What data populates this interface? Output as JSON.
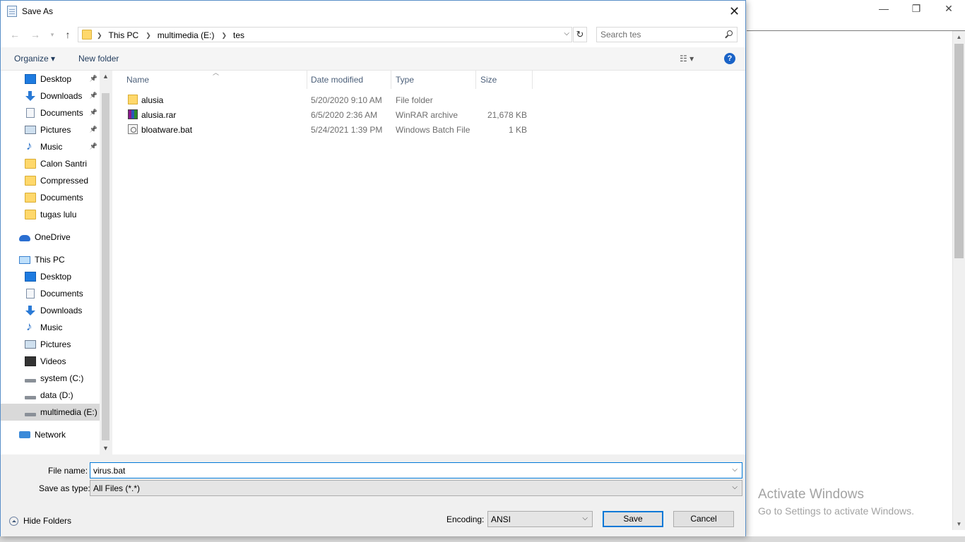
{
  "background": {
    "window_controls": [
      "—",
      "❐",
      "✕"
    ],
    "watermark": {
      "line1": "Activate Windows",
      "line2": "Go to Settings to activate Windows."
    }
  },
  "dialog": {
    "title": "Save As",
    "close_glyph": "✕"
  },
  "address": {
    "crumbs": [
      "This PC",
      "multimedia (E:)",
      "tes"
    ],
    "search_placeholder": "Search tes"
  },
  "toolbar": {
    "organize_label": "Organize ▾",
    "new_folder_label": "New folder",
    "view_glyph": "☷ ▾",
    "help_glyph": "?"
  },
  "nav_pane": {
    "items": [
      {
        "label": "Desktop",
        "icon": "desktop",
        "pinned": true
      },
      {
        "label": "Downloads",
        "icon": "down",
        "pinned": true
      },
      {
        "label": "Documents",
        "icon": "doc",
        "pinned": true
      },
      {
        "label": "Pictures",
        "icon": "pic",
        "pinned": true
      },
      {
        "label": "Music",
        "icon": "music",
        "pinned": true
      },
      {
        "label": "Calon Santri",
        "icon": "folder",
        "pinned": false
      },
      {
        "label": "Compressed",
        "icon": "folder",
        "pinned": false
      },
      {
        "label": "Documents",
        "icon": "folder",
        "pinned": false
      },
      {
        "label": "tugas lulu",
        "icon": "folder",
        "pinned": false
      },
      {
        "label": "OneDrive",
        "icon": "cloud",
        "pinned": false
      },
      {
        "label": "This PC",
        "icon": "pc",
        "pinned": false
      },
      {
        "label": "Desktop",
        "icon": "desktop",
        "pinned": false
      },
      {
        "label": "Documents",
        "icon": "doc",
        "pinned": false
      },
      {
        "label": "Downloads",
        "icon": "down",
        "pinned": false
      },
      {
        "label": "Music",
        "icon": "music",
        "pinned": false
      },
      {
        "label": "Pictures",
        "icon": "pic",
        "pinned": false
      },
      {
        "label": "Videos",
        "icon": "video",
        "pinned": false
      },
      {
        "label": "system (C:)",
        "icon": "drive-c",
        "pinned": false
      },
      {
        "label": "data (D:)",
        "icon": "drive",
        "pinned": false
      },
      {
        "label": "multimedia (E:)",
        "icon": "drive",
        "pinned": false,
        "selected": true
      },
      {
        "label": "Network",
        "icon": "net",
        "pinned": false
      }
    ]
  },
  "file_list": {
    "columns": [
      "Name",
      "Date modified",
      "Type",
      "Size"
    ],
    "rows": [
      {
        "name": "alusia",
        "date": "5/20/2020 9:10 AM",
        "type": "File folder",
        "size": "",
        "icon": "folder"
      },
      {
        "name": "alusia.rar",
        "date": "6/5/2020 2:36 AM",
        "type": "WinRAR archive",
        "size": "21,678 KB",
        "icon": "rar"
      },
      {
        "name": "bloatware.bat",
        "date": "5/24/2021 1:39 PM",
        "type": "Windows Batch File",
        "size": "1 KB",
        "icon": "bat"
      }
    ]
  },
  "bottom": {
    "file_name_label": "File name:",
    "file_name_value": "virus.bat",
    "save_type_label": "Save as type:",
    "save_type_value": "All Files  (*.*)",
    "hide_folders_label": "Hide Folders",
    "encoding_label": "Encoding:",
    "encoding_value": "ANSI",
    "save_label": "Save",
    "cancel_label": "Cancel"
  },
  "colors": {
    "accent": "#0078d7",
    "folder": "#ffd86b",
    "watermark": "#a3a3a3"
  }
}
